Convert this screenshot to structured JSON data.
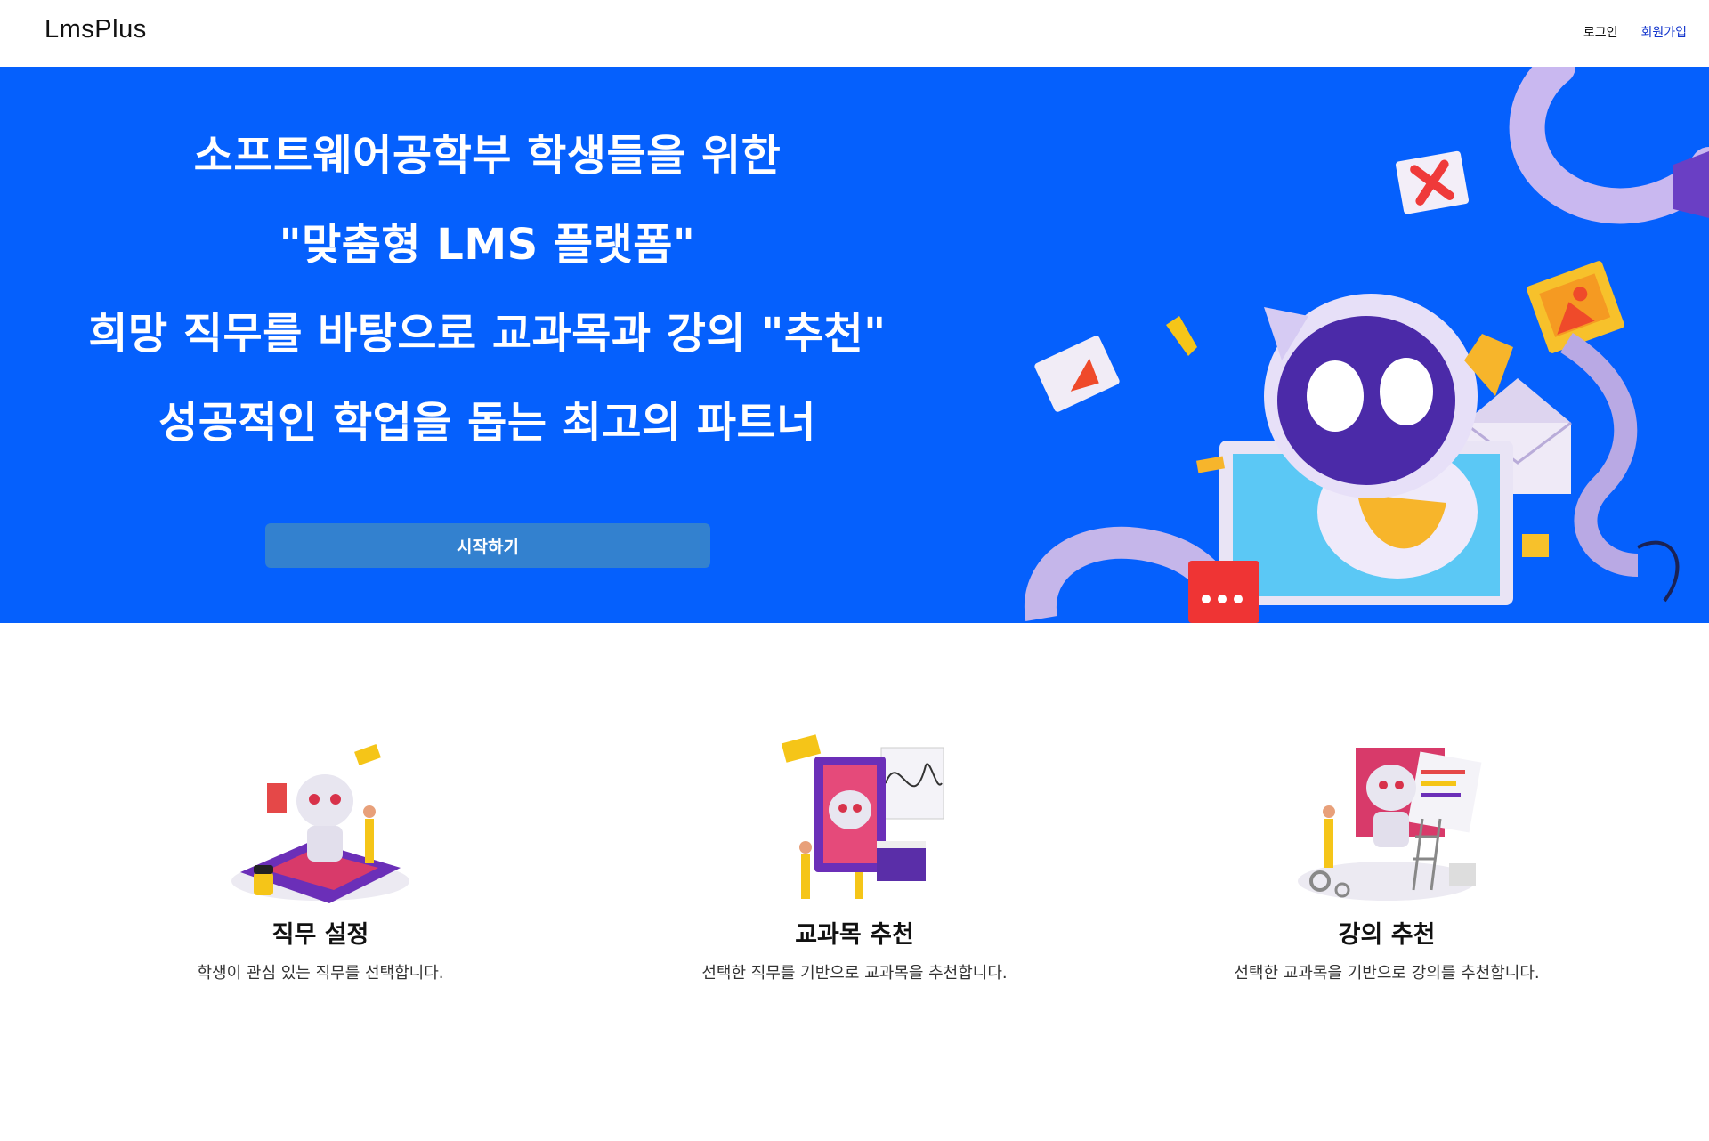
{
  "header": {
    "logo": "LmsPlus",
    "login": "로그인",
    "signup": "회원가입"
  },
  "hero": {
    "line1": "소프트웨어공학부 학생들을 위한",
    "line2": "\"맞춤형 LMS 플랫폼\"",
    "line3_pre": "희망 직무를 바탕으로 교과목과 강의 ",
    "line3_bold": "\"추천\"",
    "line4_pre": "성공적인 학업을 돕는 최고의 ",
    "line4_bold": "파트너",
    "start_button": "시작하기",
    "bg_color": "#0560fd",
    "button_color": "#3381cf"
  },
  "features": [
    {
      "title": "직무 설정",
      "desc": "학생이 관심 있는 직무를 선택합니다.",
      "icon": "robot-job-illustration"
    },
    {
      "title": "교과목 추천",
      "desc": "선택한 직무를 기반으로 교과목을 추천합니다.",
      "icon": "robot-course-illustration"
    },
    {
      "title": "강의 추천",
      "desc": "선택한 교과목을 기반으로 강의를 추천합니다.",
      "icon": "robot-lecture-illustration"
    }
  ]
}
